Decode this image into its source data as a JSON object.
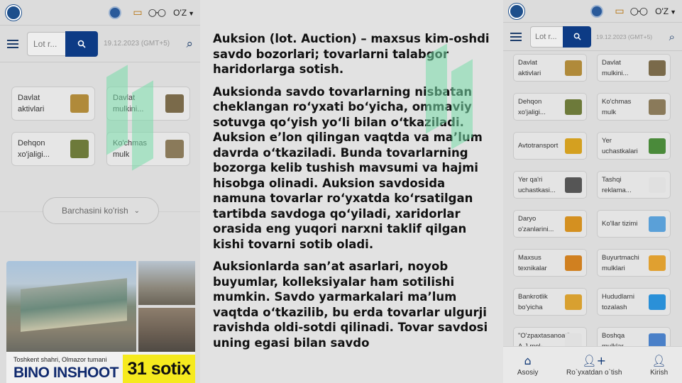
{
  "left": {
    "lang": "O'Z",
    "search": {
      "placeholder": "Lot r..."
    },
    "date": "19.12.2023 (GMT+5)",
    "categories": [
      {
        "label": "Davlat aktivlari",
        "color": "#b08a3a"
      },
      {
        "label": "Davlat mulkini...",
        "color": "#7a6a4a"
      },
      {
        "label": "Dehqon xo'jaligi...",
        "color": "#6d7a3a"
      },
      {
        "label": "Ko'chmas mulk",
        "color": "#8a7a5a"
      }
    ],
    "show_all": "Barchasini ko'rish",
    "banner": {
      "location": "Toshkent shahri, Olmazor tumani",
      "title": "BINO INSHOOT",
      "area": "31 sotix"
    }
  },
  "middle": {
    "paragraphs": [
      "Auksion (lot. Auction) – maxsus kim-oshdi savdo bozorlari; tovarlarni talabgor haridorlarga sotish.",
      "Auksionda savdo tovarlarning nisbatan cheklangan ro‘yxati bo‘yicha, ommaviy sotuvga qo‘yish yo‘li bilan o‘tkaziladi. Auksion e’lon qilingan vaqtda va ma’lum davrda o‘tkaziladi. Bunda tovarlarning bozorga kelib tushish mavsumi va hajmi hisobga olinadi. Auksion savdosida namuna tovarlar ro‘yxatda ko‘rsatilgan tartibda savdoga qo‘yiladi, xaridorlar orasida eng yuqori narxni taklif qilgan kishi tovarni sotib oladi.",
      "Auksionlarda san’at asarlari, noyob buyumlar, kolleksiyalar ham sotilishi mumkin. Savdo yarmarkalari ma’lum vaqtda o‘tkazilib, bu erda tovarlar ulgurji ravishda oldi-sotdi qilinadi. Tovar savdosi uning egasi bilan savdo"
    ]
  },
  "right": {
    "lang": "O'Z",
    "search": {
      "placeholder": "Lot r..."
    },
    "date": "19.12.2023 (GMT+5)",
    "categories": [
      {
        "label": "Davlat aktivlari",
        "color": "#b08a3a"
      },
      {
        "label": "Davlat mulkini...",
        "color": "#7a6a4a"
      },
      {
        "label": "Dehqon xo'jaligi...",
        "color": "#6d7a3a"
      },
      {
        "label": "Ko'chmas mulk",
        "color": "#8a7a5a"
      },
      {
        "label": "Avtotransport",
        "color": "#d4a020"
      },
      {
        "label": "Yer uchastkalari",
        "color": "#4a8a3a"
      },
      {
        "label": "Yer qa'ri uchastkasi...",
        "color": "#555555"
      },
      {
        "label": "Tashqi reklama...",
        "color": "#e0e0e0"
      },
      {
        "label": "Daryo o'zanlarini...",
        "color": "#d49020"
      },
      {
        "label": "Ko'llar tizimi",
        "color": "#5aa0d8"
      },
      {
        "label": "Maxsus texnikalar",
        "color": "#d08020"
      },
      {
        "label": "Buyurtmachi mulklari",
        "color": "#e0a030"
      },
      {
        "label": "Bankrotlik bo'yicha",
        "color": "#d8a030"
      },
      {
        "label": "Hududlarni tozalash",
        "color": "#2a90d8"
      },
      {
        "label": "\"O'zpaxtasanoat\" A.J mol-...",
        "color": "#e0e0e0"
      },
      {
        "label": "Boshqa mulklar",
        "color": "#4a80c8"
      }
    ],
    "nav": [
      {
        "label": "Asosiy",
        "icon": "home-icon"
      },
      {
        "label": "Ro`yxatdan o`tish",
        "icon": "add-user-icon"
      },
      {
        "label": "Kirish",
        "icon": "user-icon"
      }
    ]
  }
}
